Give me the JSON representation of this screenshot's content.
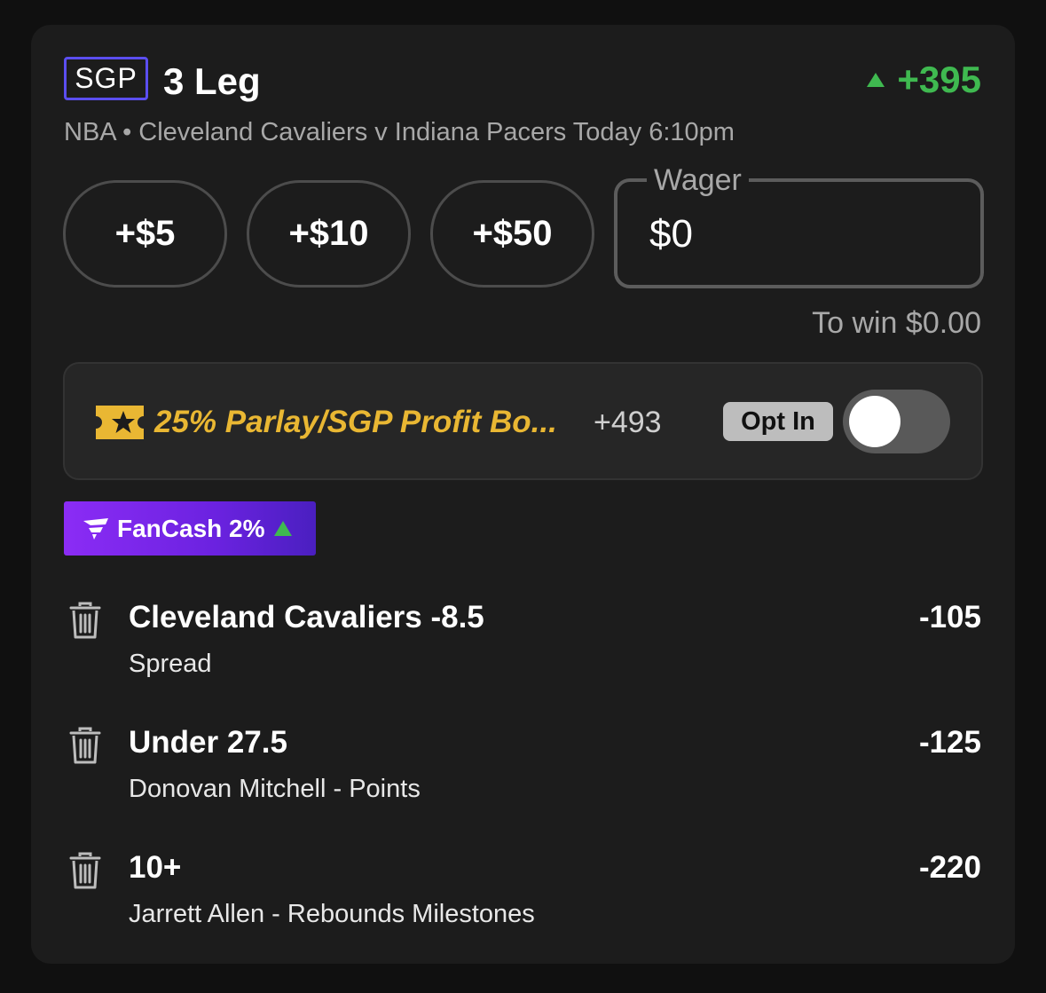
{
  "header": {
    "badge": "SGP",
    "title": "3 Leg",
    "odds": "+395",
    "subtitle": "NBA • Cleveland Cavaliers v Indiana Pacers Today 6:10pm"
  },
  "quick_add": {
    "buttons": [
      "+$5",
      "+$10",
      "+$50"
    ]
  },
  "wager": {
    "label": "Wager",
    "value": "$0",
    "to_win": "To win $0.00"
  },
  "boost": {
    "text": "25% Parlay/SGP Profit Bo...",
    "odds": "+493",
    "opt_in_label": "Opt In",
    "toggle_on": false,
    "accent_color": "#e9b733"
  },
  "fancash": {
    "label": "FanCash 2%"
  },
  "legs": [
    {
      "name": "Cleveland Cavaliers -8.5",
      "desc": "Spread",
      "odds": "-105"
    },
    {
      "name": "Under 27.5",
      "desc": "Donovan Mitchell - Points",
      "odds": "-125"
    },
    {
      "name": "10+",
      "desc": "Jarrett Allen - Rebounds Milestones",
      "odds": "-220"
    }
  ],
  "colors": {
    "positive": "#3fb950",
    "sgp_border": "#5b4ef0",
    "fancash_purple": "#8b2cf5"
  }
}
